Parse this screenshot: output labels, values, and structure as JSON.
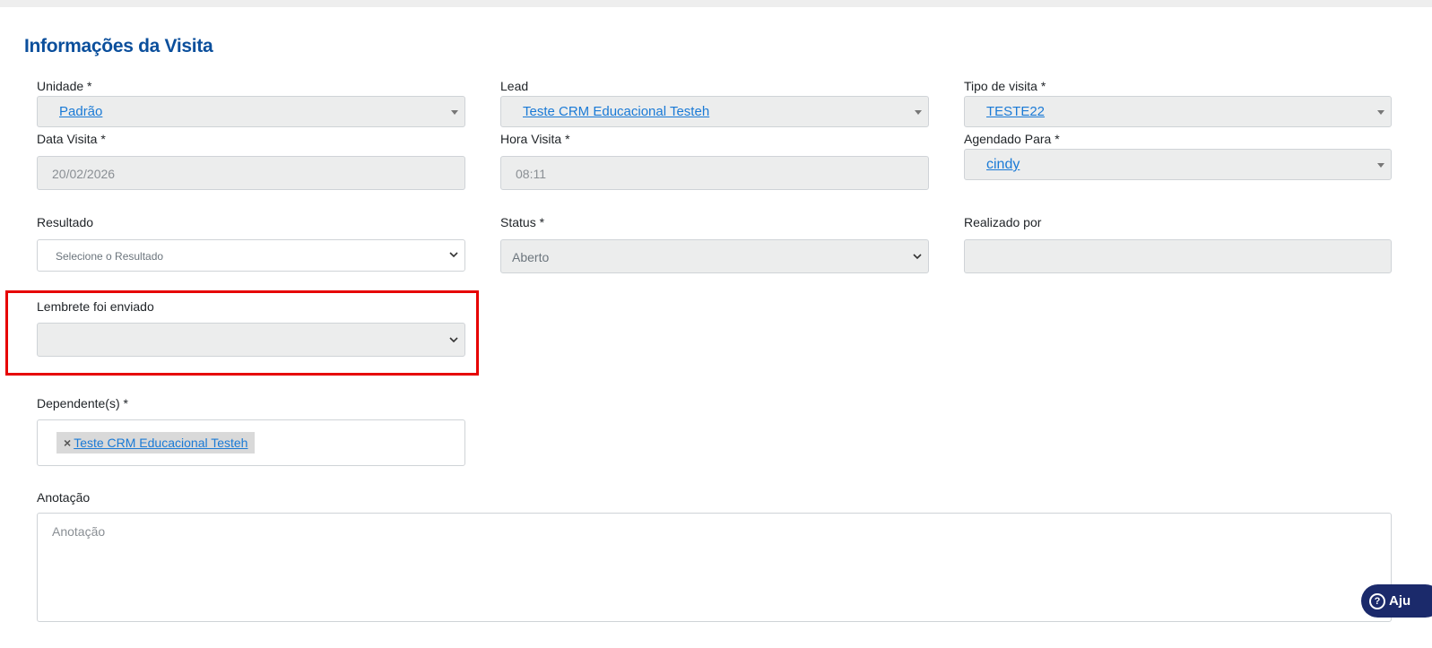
{
  "section": {
    "title": "Informações da Visita"
  },
  "fields": {
    "unidade": {
      "label": "Unidade *",
      "value": "Padrão"
    },
    "lead": {
      "label": "Lead",
      "value": "Teste CRM Educacional Testeh"
    },
    "tipo_visita": {
      "label": "Tipo de visita *",
      "value": "TESTE22"
    },
    "data_visita": {
      "label": "Data Visita *",
      "value": "20/02/2026"
    },
    "hora_visita": {
      "label": "Hora Visita *",
      "value": "08:11"
    },
    "agendado_para": {
      "label": "Agendado Para *",
      "value": "cindy"
    },
    "resultado": {
      "label": "Resultado",
      "value": "Selecione o Resultado"
    },
    "status": {
      "label": "Status *",
      "value": "Aberto"
    },
    "realizado_por": {
      "label": "Realizado por",
      "value": ""
    },
    "lembrete": {
      "label": "Lembrete foi enviado",
      "value": ""
    },
    "dependentes": {
      "label": "Dependente(s) *",
      "tags": [
        "Teste CRM Educacional Testeh"
      ]
    },
    "anotacao": {
      "label": "Anotação",
      "placeholder": "Anotação"
    }
  },
  "help_button": {
    "label": "Aju"
  },
  "colors": {
    "title": "#0b4f9c",
    "link": "#1a7ad6",
    "highlight": "#e60000",
    "help_bg": "#1b2a6b"
  },
  "icons": {
    "caret": "caret-down-icon",
    "chevron": "chevron-down-icon",
    "remove": "close-icon",
    "help": "question-circle-icon"
  }
}
